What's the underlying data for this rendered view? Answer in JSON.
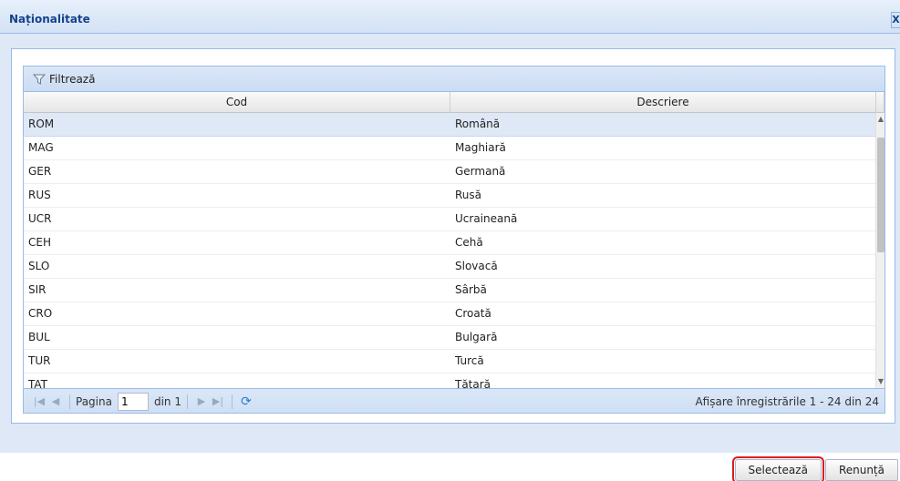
{
  "window": {
    "title": "Naționalitate",
    "close_label": "X"
  },
  "grid": {
    "filter_label": "Filtrează",
    "columns": [
      "Cod",
      "Descriere"
    ],
    "rows": [
      {
        "cod": "ROM",
        "descriere": "Română"
      },
      {
        "cod": "MAG",
        "descriere": "Maghiară"
      },
      {
        "cod": "GER",
        "descriere": "Germană"
      },
      {
        "cod": "RUS",
        "descriere": "Rusă"
      },
      {
        "cod": "UCR",
        "descriere": "Ucraineană"
      },
      {
        "cod": "CEH",
        "descriere": "Cehă"
      },
      {
        "cod": "SLO",
        "descriere": "Slovacă"
      },
      {
        "cod": "SIR",
        "descriere": "Sârbă"
      },
      {
        "cod": "CRO",
        "descriere": "Croată"
      },
      {
        "cod": "BUL",
        "descriere": "Bulgară"
      },
      {
        "cod": "TUR",
        "descriere": "Turcă"
      },
      {
        "cod": "TAT",
        "descriere": "Tătară"
      }
    ],
    "selected_index": 0
  },
  "paging": {
    "page_label": "Pagina",
    "page_value": "1",
    "of_label": "din 1",
    "info": "Afișare înregistrările 1 - 24 din 24"
  },
  "buttons": {
    "select_label": "Selectează",
    "cancel_label": "Renunță"
  }
}
